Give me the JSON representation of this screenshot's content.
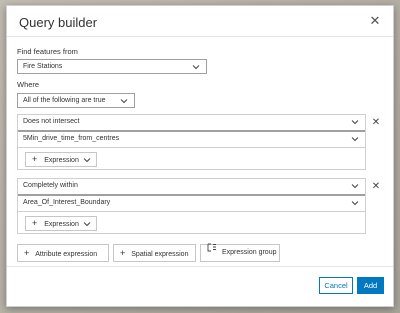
{
  "dialog": {
    "title": "Query builder",
    "find_features_label": "Find features from",
    "layer_value": "Fire Stations",
    "where_label": "Where",
    "match_value": "All of the following are true"
  },
  "expressions": [
    {
      "relation": "Does not intersect",
      "target_layer": "5Min_drive_time_from_centres",
      "expression_button": "Expression"
    },
    {
      "relation": "Completely within",
      "target_layer": "Area_Of_Interest_Boundary",
      "expression_button": "Expression"
    }
  ],
  "add_buttons": {
    "attribute": "Attribute expression",
    "spatial": "Spatial expression",
    "group": "Expression group"
  },
  "footer": {
    "cancel_label": "Cancel",
    "add_label": "Add"
  },
  "colors": {
    "accent": "#0079c1"
  },
  "icons": {
    "close": "close-icon",
    "chevron": "chevron-down-icon",
    "plus": "plus-icon",
    "group": "expression-group-icon"
  }
}
